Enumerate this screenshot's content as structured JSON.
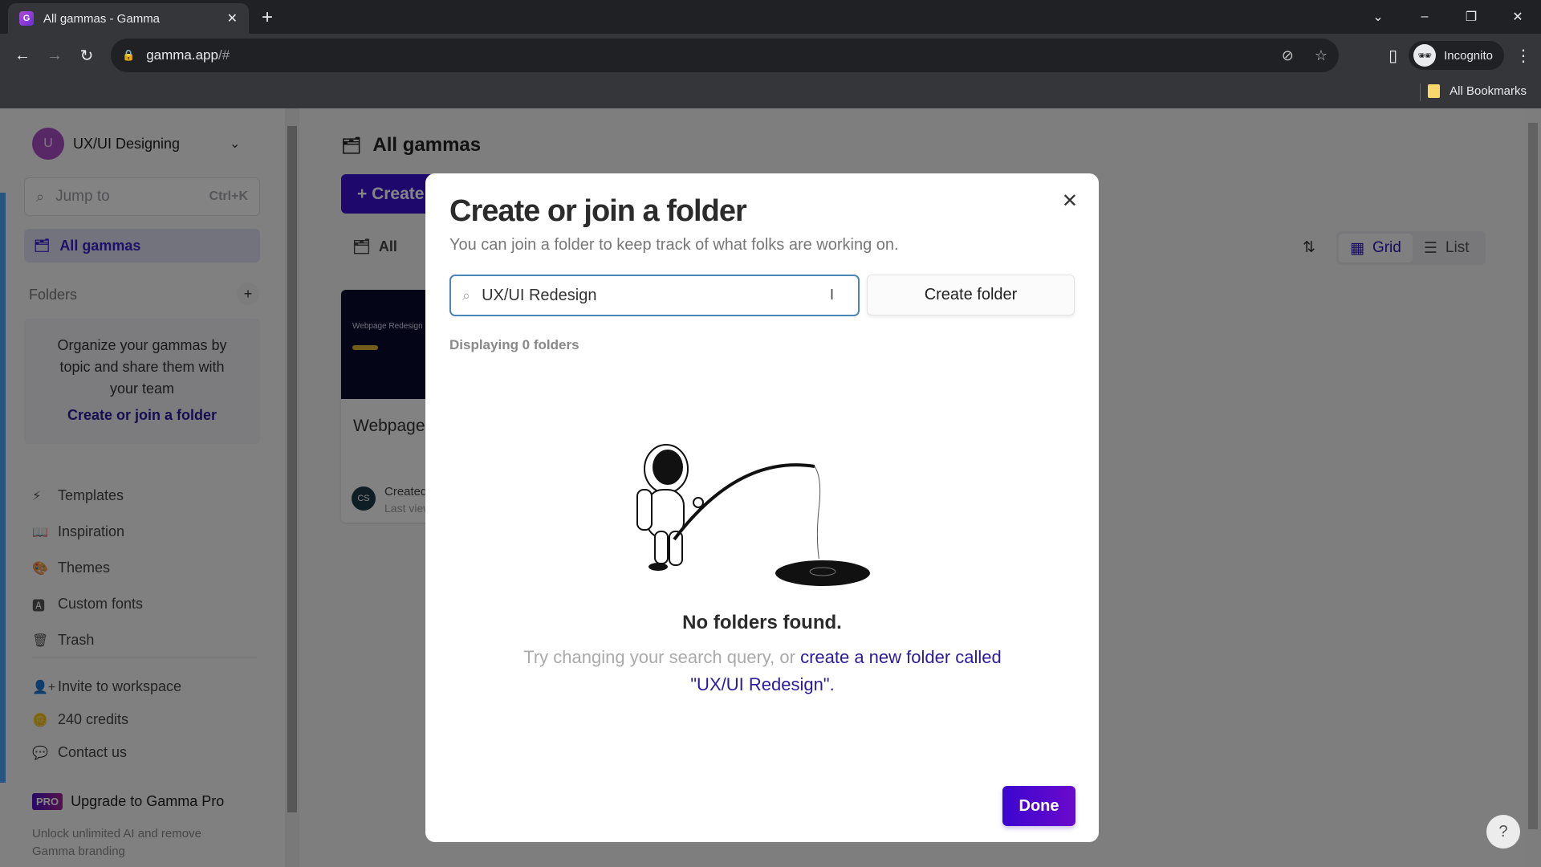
{
  "browser": {
    "tab_title": "All gammas - Gamma",
    "url_host": "gamma.app",
    "url_path": "/#",
    "profile_label": "Incognito",
    "bookmarks_label": "All Bookmarks",
    "icons": {
      "back": "←",
      "forward": "→",
      "reload": "↻",
      "lock": "🔒",
      "eye_off": "⊘",
      "star": "☆",
      "side_panel": "▯",
      "menu": "⋮",
      "new_tab": "+",
      "tab_close": "✕",
      "tab_search": "⌄",
      "minimize": "–",
      "restore": "❐",
      "close": "✕"
    }
  },
  "sidebar": {
    "workspace_initial": "U",
    "workspace_name": "UX/UI Designing",
    "jump_placeholder": "Jump to",
    "jump_shortcut": "Ctrl+K",
    "active_item": "All gammas",
    "folders_heading": "Folders",
    "folders_empty_text": "Organize your gammas by topic and share them with your team",
    "folders_empty_link": "Create or join a folder",
    "items": [
      {
        "label": "Templates",
        "icon": "⚡"
      },
      {
        "label": "Inspiration",
        "icon": "📖"
      },
      {
        "label": "Themes",
        "icon": "🎨"
      },
      {
        "label": "Custom fonts",
        "icon": "🅰"
      },
      {
        "label": "Trash",
        "icon": "🗑"
      }
    ],
    "items2": [
      {
        "label": "Invite to workspace",
        "icon": "👤+"
      },
      {
        "label": "240 credits",
        "icon": "🪙"
      },
      {
        "label": "Contact us",
        "icon": "💬"
      }
    ],
    "pro_badge": "PRO",
    "pro_label": "Upgrade to Gamma Pro",
    "pro_desc": "Unlock unlimited AI and remove Gamma branding"
  },
  "main": {
    "title": "All gammas",
    "create_label": "+ Create",
    "filter_all": "All",
    "view_grid": "Grid",
    "view_list": "List",
    "card": {
      "thumb_title": "Webpage Redesign",
      "name": "Webpage",
      "avatar": "CS",
      "meta1": "Created",
      "meta2": "Last viewed"
    },
    "help": "?"
  },
  "modal": {
    "title": "Create or join a folder",
    "subtitle": "You can join a folder to keep track of what folks are working on.",
    "search_value": "UX/UI Redesign",
    "create_button": "Create folder",
    "count_text": "Displaying 0 folders",
    "empty_title": "No folders found.",
    "empty_desc_prefix": "Try changing your search query, or ",
    "empty_desc_link": "create a new folder called \"UX/UI Redesign\".",
    "done_button": "Done",
    "close_icon": "✕"
  },
  "colors": {
    "brand": "#3d10cf",
    "link": "#2a1a9e",
    "input_border": "#4a85b8"
  }
}
